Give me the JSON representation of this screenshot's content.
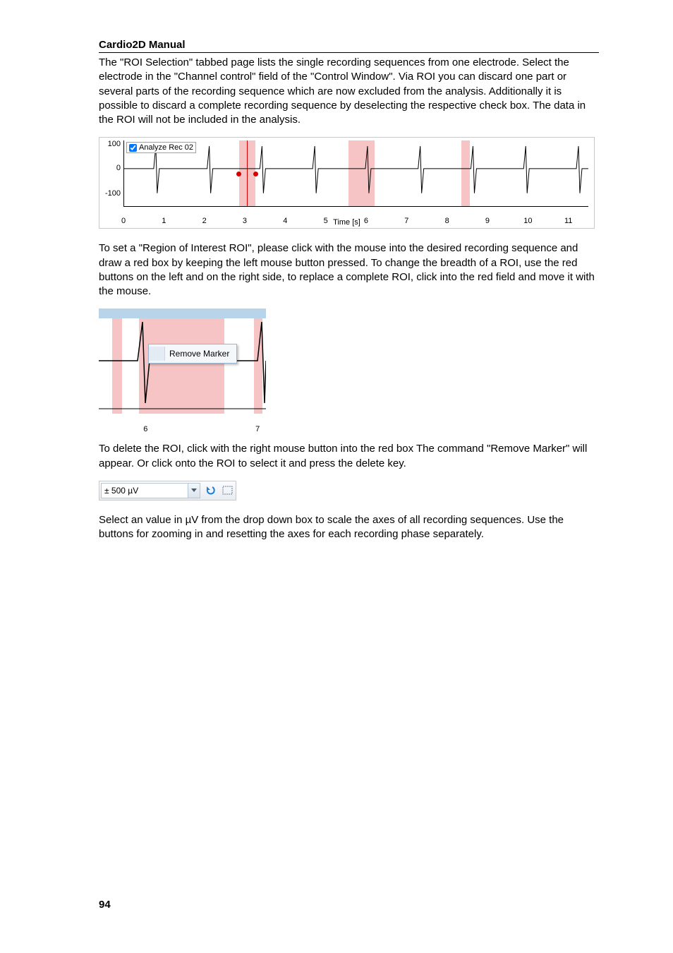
{
  "header": "Cardio2D Manual",
  "page_number": "94",
  "para1": "The \"ROI Selection\" tabbed page lists the single recording sequences from one electrode. Select the electrode in the \"Channel control\" field of the \"Control Window\". Via ROI you can discard one part or several parts of the recording sequence which are now excluded from the analysis. Additionally it is possible to discard a complete recording sequence by deselecting the respective check box. The data in the ROI will not be included in the analysis.",
  "para2": "To set a \"Region of Interest ROI\", please click with the mouse into the desired recording sequence and draw a red box by keeping the left mouse button pressed. To change the breadth of a ROI, use the red buttons on the left and on the right side, to replace a complete ROI, click into the red field and move it with the mouse.",
  "para3": "To delete the ROI, click with the right mouse button into the red box The command \"Remove Marker\" will appear. Or click onto the ROI to select it and press the delete key.",
  "para4": "Select an value in µV from the drop down box to scale the axes of all recording sequences. Use the buttons for zooming in and resetting the axes for each recording phase separately.",
  "fig1": {
    "checkbox_label": "Analyze Rec 02",
    "checkbox_checked": true,
    "xlabel": "Time [s]",
    "yticks": [
      "100",
      "0",
      "-100"
    ],
    "xticks": [
      "0",
      "1",
      "2",
      "3",
      "4",
      "5",
      "6",
      "7",
      "8",
      "9",
      "10",
      "11"
    ],
    "roi": [
      {
        "start_s": 2.85,
        "end_s": 3.25
      },
      {
        "start_s": 5.55,
        "end_s": 6.2
      },
      {
        "start_s": 8.35,
        "end_s": 8.55
      }
    ]
  },
  "fig2": {
    "menu_item": "Remove Marker",
    "xticks": [
      "6",
      "7"
    ],
    "roi": [
      {
        "left_pct": 8,
        "width_pct": 6
      },
      {
        "left_pct": 24,
        "width_pct": 51
      },
      {
        "left_pct": 93,
        "width_pct": 5
      }
    ]
  },
  "fig3": {
    "value": "± 500 µV"
  },
  "chart_data": {
    "type": "line",
    "title": "Analyze Rec 02",
    "xlabel": "Time [s]",
    "ylabel": "",
    "xlim": [
      0,
      11.5
    ],
    "ylim": [
      -150,
      120
    ],
    "x_ticks": [
      0,
      1,
      2,
      3,
      4,
      5,
      6,
      7,
      8,
      9,
      10,
      11
    ],
    "y_ticks": [
      -100,
      0,
      100
    ],
    "rois": [
      {
        "start": 2.85,
        "end": 3.25
      },
      {
        "start": 5.55,
        "end": 6.2
      },
      {
        "start": 8.35,
        "end": 8.55
      }
    ],
    "notes": "Periodic cardiac-like waveform, one spike roughly every 1.3 s between baseline ~0 and peaks near ±100; ROIs highlighted in pink are excluded from analysis."
  }
}
